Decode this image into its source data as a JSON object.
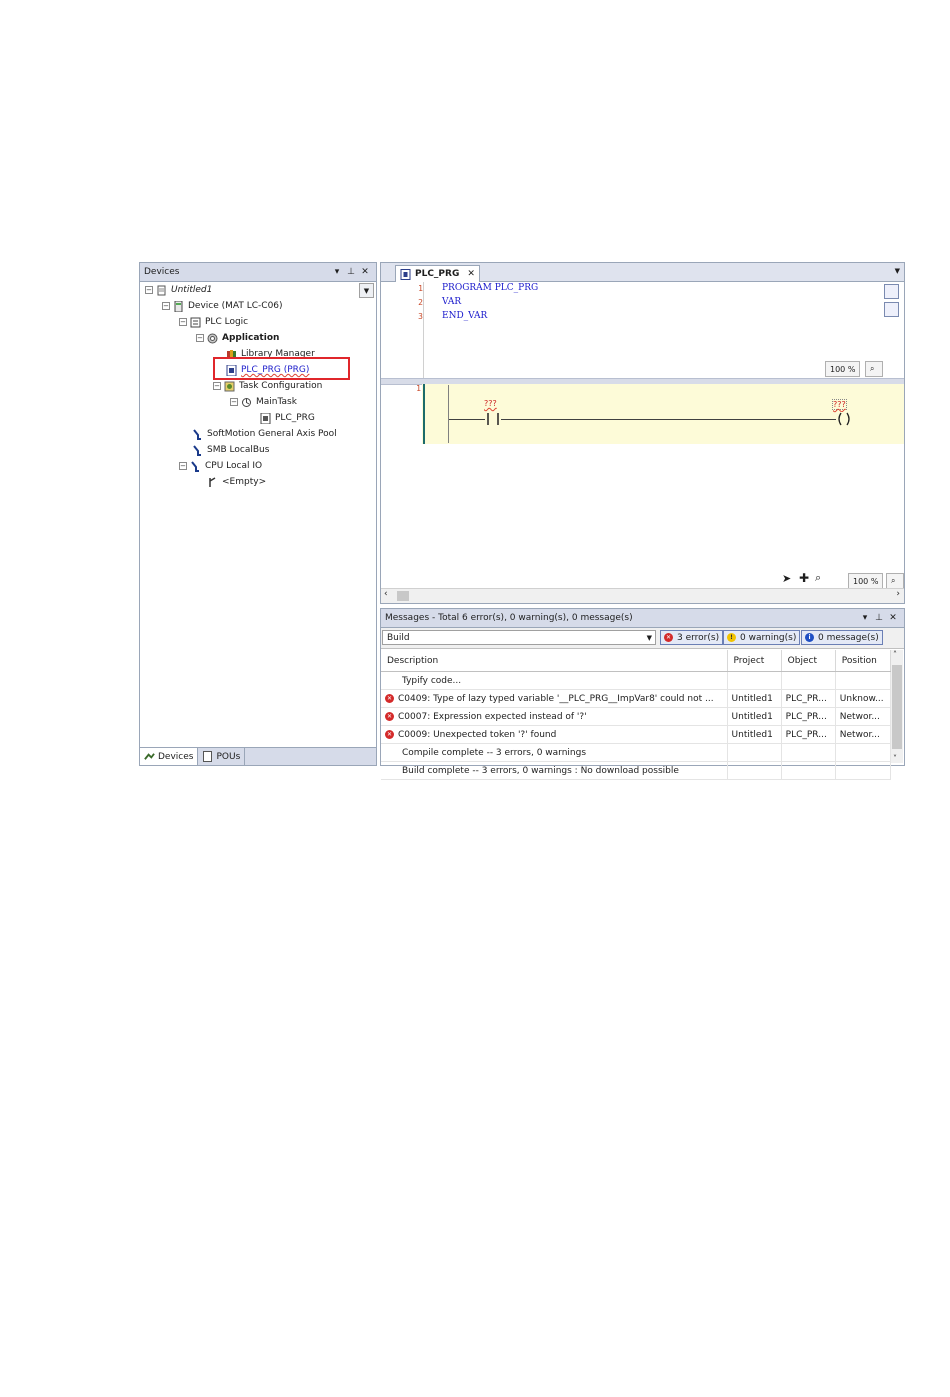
{
  "devices_pane": {
    "title": "Devices",
    "tree": [
      {
        "label": "Untitled1",
        "style": "italic"
      },
      {
        "label": "Device (MAT LC-C06)"
      },
      {
        "label": "PLC Logic"
      },
      {
        "label": "Application",
        "style": "bold"
      },
      {
        "label": "Library Manager"
      },
      {
        "label": "PLC_PRG (PRG)",
        "style": "link"
      },
      {
        "label": "Task Configuration"
      },
      {
        "label": "MainTask"
      },
      {
        "label": "PLC_PRG"
      },
      {
        "label": "SoftMotion General Axis Pool"
      },
      {
        "label": "SMB LocalBus"
      },
      {
        "label": "CPU Local IO"
      },
      {
        "label": "<Empty>"
      }
    ],
    "bottom_tabs": [
      "Devices",
      "POUs"
    ],
    "expander": "−"
  },
  "editor": {
    "tab_label": "PLC_PRG",
    "close": "✕",
    "code_lines": [
      {
        "num": "1",
        "text": "PROGRAM PLC_PRG"
      },
      {
        "num": "2",
        "text": "VAR"
      },
      {
        "num": "3",
        "text": "END_VAR"
      }
    ],
    "decl_zoom": "100 %",
    "network_num": "1",
    "contact_label": "???",
    "coil_label": "???",
    "ladder_zoom": "100 %"
  },
  "messages": {
    "title": "Messages - Total 6 error(s), 0 warning(s), 0 message(s)",
    "category": "Build",
    "errors_btn": "3 error(s)",
    "warnings_btn": "0 warning(s)",
    "messages_btn": "0 message(s)",
    "columns": [
      "Description",
      "Project",
      "Object",
      "Position"
    ],
    "rows": [
      {
        "icon": "",
        "description": "Typify code...",
        "project": "",
        "object": "",
        "position": ""
      },
      {
        "icon": "error",
        "description": "C0409: Type of lazy typed variable '__PLC_PRG__ImpVar8' could not ...",
        "project": "Untitled1",
        "object": "PLC_PR...",
        "position": "Unknow..."
      },
      {
        "icon": "error",
        "description": "C0007: Expression expected instead of '?'",
        "project": "Untitled1",
        "object": "PLC_PR...",
        "position": "Networ..."
      },
      {
        "icon": "error",
        "description": "C0009: Unexpected token '?' found",
        "project": "Untitled1",
        "object": "PLC_PR...",
        "position": "Networ..."
      },
      {
        "icon": "",
        "description": "Compile complete -- 3 errors, 0 warnings",
        "project": "",
        "object": "",
        "position": ""
      },
      {
        "icon": "",
        "description": "Build complete -- 3 errors, 0 warnings : No download possible",
        "project": "",
        "object": "",
        "position": ""
      }
    ]
  },
  "colors": {
    "error": "#d42a2a",
    "warning": "#f2c300",
    "info": "#1f4fc4",
    "highlight": "#e0262b"
  }
}
